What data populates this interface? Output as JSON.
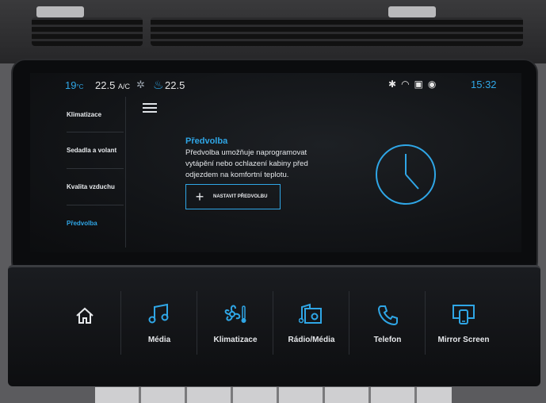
{
  "status": {
    "temp_left": "19",
    "temp_left_unit": "°C",
    "temp_mid": "22.5",
    "ac_label": "A/C",
    "temp_right": "22.5",
    "time": "15:32",
    "icons": [
      "bluetooth-icon",
      "wifi-icon",
      "car-icon",
      "location-icon"
    ]
  },
  "sidebar": {
    "items": [
      {
        "label": "Klimatizace",
        "active": false
      },
      {
        "label": "Sedadla a volant",
        "active": false
      },
      {
        "label": "Kvalita vzduchu",
        "active": false
      },
      {
        "label": "Předvolba",
        "active": true
      }
    ]
  },
  "content": {
    "title": "Předvolba",
    "description": "Předvolba umožňuje naprogramovat vytápění nebo ochlazení kabiny před odjezdem na komfortní teplotu.",
    "button_label": "NASTAVIT PŘEDVOLBU"
  },
  "touchbar": {
    "items": [
      {
        "label": "",
        "icon": "home-icon"
      },
      {
        "label": "Média",
        "icon": "music-icon"
      },
      {
        "label": "Klimatizace",
        "icon": "fan-icon"
      },
      {
        "label": "Rádio/Média",
        "icon": "radio-icon"
      },
      {
        "label": "Telefon",
        "icon": "phone-icon"
      },
      {
        "label": "Mirror Screen",
        "icon": "mirror-screen-icon"
      }
    ]
  },
  "colors": {
    "accent": "#2fa6e6",
    "screen_bg": "#121417",
    "text": "#e6e8eb"
  }
}
